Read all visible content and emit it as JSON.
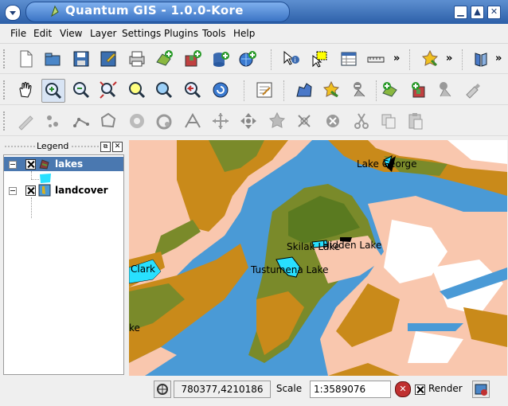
{
  "window": {
    "title": "Quantum GIS - 1.0.0-Kore",
    "minimize": "▁",
    "maximize": "▲",
    "close": "✕"
  },
  "menu": [
    "File",
    "Edit",
    "View",
    "Layer",
    "Settings",
    "Plugins",
    "Tools",
    "Help"
  ],
  "toolbar_extension": "»",
  "legend": {
    "title": "Legend",
    "layers": [
      {
        "name": "lakes",
        "selected": true,
        "symbol_color": "#28e0ff"
      },
      {
        "name": "landcover",
        "selected": false
      }
    ]
  },
  "map": {
    "labels": [
      "Lake George",
      "Skilak Lake",
      "Hidden Lake",
      "Tustumena Lake",
      "Clark",
      "ke"
    ],
    "colors": {
      "water": "#4a9ad6",
      "tundra": "#f9c7ae",
      "forest": "#7a8a2a",
      "shrub": "#c98a1a",
      "lake": "#28e0ff",
      "snow": "#ffffff"
    }
  },
  "status": {
    "coordinates": "780377,4210186",
    "scale_label": "Scale",
    "scale_value": "1:3589076",
    "render_label": "Render"
  }
}
